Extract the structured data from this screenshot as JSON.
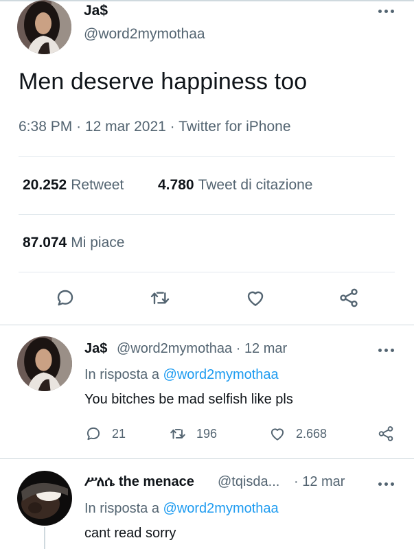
{
  "main_tweet": {
    "author_name": "Ja$",
    "author_handle": "@word2mymothaa",
    "text": "Men deserve happiness too",
    "time": "6:38 PM",
    "date": "12 mar 2021",
    "source": "Twitter for iPhone",
    "stats": {
      "retweets_count": "20.252",
      "retweets_label": "Retweet",
      "quotes_count": "4.780",
      "quotes_label": "Tweet di citazione",
      "likes_count": "87.074",
      "likes_label": "Mi piace"
    },
    "actions": [
      "reply-icon",
      "retweet-icon",
      "like-icon",
      "share-icon"
    ]
  },
  "replies": [
    {
      "author_name": "Ja$",
      "author_handle": "@word2mymothaa",
      "date": "12 mar",
      "in_reply_prefix": "In risposta a",
      "in_reply_handle": "@word2mymothaa",
      "text": "You bitches be mad selfish like pls",
      "reply_count": "21",
      "retweet_count": "196",
      "like_count": "2.668"
    },
    {
      "author_name": "ሥለሴ the menace",
      "author_handle": "@tqisda...",
      "date": "12 mar",
      "in_reply_prefix": "In risposta a",
      "in_reply_handle": "@word2mymothaa",
      "text": "cant read sorry"
    }
  ],
  "colors": {
    "text": "#0f1419",
    "secondary": "#536471",
    "link": "#1d9bf0",
    "divider": "#e1e8ed"
  }
}
